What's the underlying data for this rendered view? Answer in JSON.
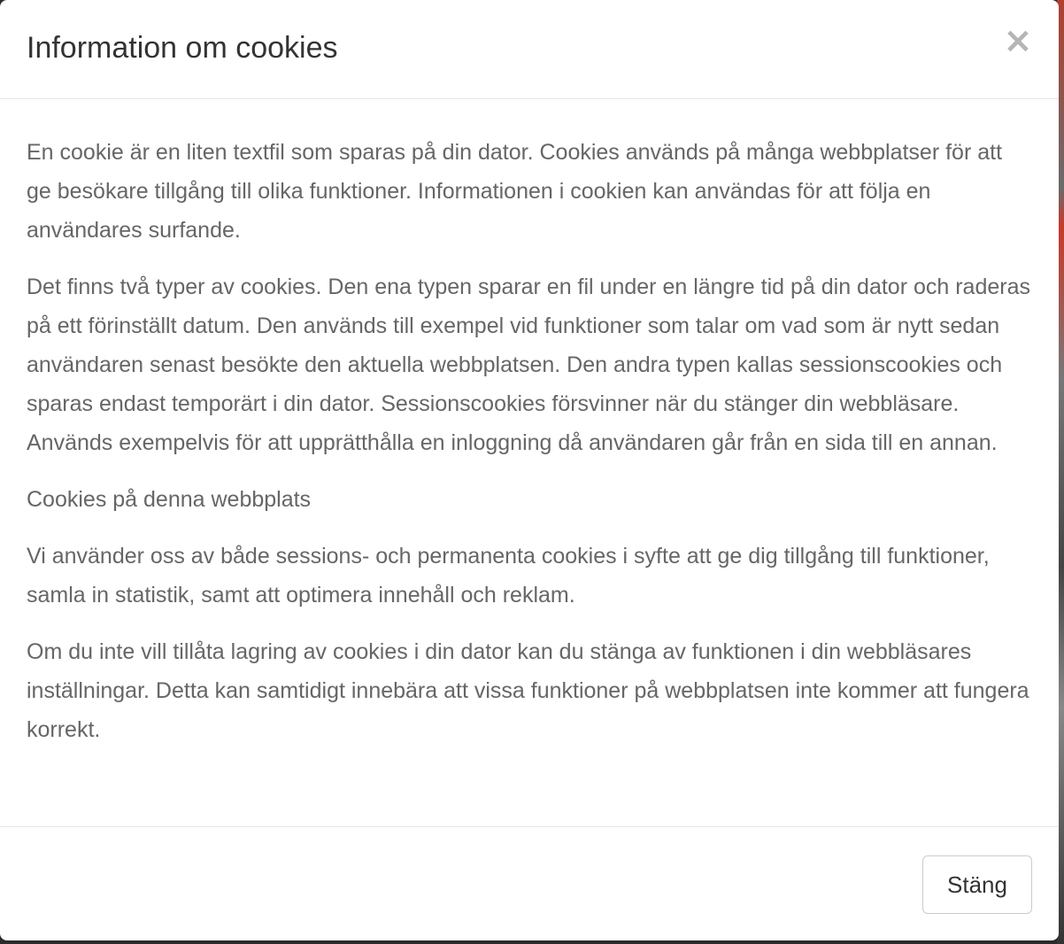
{
  "modal": {
    "title": "Information om cookies",
    "close_icon_glyph": "×",
    "paragraphs": [
      "En cookie är en liten textfil som sparas på din dator. Cookies används på många webbplatser för att ge besökare tillgång till olika funktioner. Informationen i cookien kan användas för att följa en användares surfande.",
      "Det finns två typer av cookies. Den ena typen sparar en fil under en längre tid på din dator och raderas på ett förinställt datum. Den används till exempel vid funktioner som talar om vad som är nytt sedan användaren senast besökte den aktuella webbplatsen. Den andra typen kallas sessionscookies och sparas endast temporärt i din dator. Sessionscookies försvinner när du stänger din webbläsare. Används exempelvis för att upprätthålla en inloggning då användaren går från en sida till en annan.",
      "Cookies på denna webbplats",
      "Vi använder oss av både sessions- och permanenta cookies i syfte att ge dig tillgång till funktioner, samla in statistik, samt att optimera innehåll och reklam.",
      "Om du inte vill tillåta lagring av cookies i din dator kan du stänga av funktionen i din webbläsares inställningar. Detta kan samtidigt innebära att vissa funktioner på webbplatsen inte kommer att fungera korrekt."
    ],
    "footer": {
      "close_label": "Stäng"
    }
  },
  "icons": {
    "close": "close-icon"
  },
  "colors": {
    "title": "#333333",
    "body_text": "#666666",
    "close_icon": "#b5b5b5",
    "divider": "#e5e5e5",
    "button_border": "#cccccc"
  }
}
